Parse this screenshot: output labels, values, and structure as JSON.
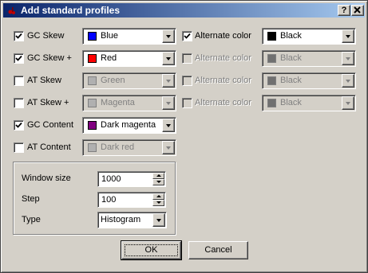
{
  "window": {
    "title": "Add standard profiles",
    "help_label": "?",
    "close_label": "✕"
  },
  "profiles": [
    {
      "label": "GC Skew",
      "checked": true,
      "enabled": true,
      "color_name": "Blue",
      "color": "#0000ff",
      "alt_label": "Alternate color",
      "alt_checked": true,
      "alt_enabled": true,
      "alt_color_name": "Black",
      "alt_color": "#000000"
    },
    {
      "label": "GC Skew +",
      "checked": true,
      "enabled": true,
      "color_name": "Red",
      "color": "#ff0000",
      "alt_label": "Alternate color",
      "alt_checked": false,
      "alt_enabled": false,
      "alt_color_name": "Black",
      "alt_color": "#000000"
    },
    {
      "label": "AT Skew",
      "checked": false,
      "enabled": false,
      "color_name": "Green",
      "color": "#00c000",
      "alt_label": "Alternate color",
      "alt_checked": false,
      "alt_enabled": false,
      "alt_color_name": "Black",
      "alt_color": "#000000"
    },
    {
      "label": "AT Skew +",
      "checked": false,
      "enabled": false,
      "color_name": "Magenta",
      "color": "#ff00ff",
      "alt_label": "Alternate color",
      "alt_checked": false,
      "alt_enabled": false,
      "alt_color_name": "Black",
      "alt_color": "#000000"
    },
    {
      "label": "GC Content",
      "checked": true,
      "enabled": true,
      "color_name": "Dark magenta",
      "color": "#800080"
    },
    {
      "label": "AT Content",
      "checked": false,
      "enabled": false,
      "color_name": "Dark red",
      "color": "#800000"
    }
  ],
  "settings": {
    "window_size_label": "Window size",
    "window_size_value": "1000",
    "step_label": "Step",
    "step_value": "100",
    "type_label": "Type",
    "type_value": "Histogram"
  },
  "buttons": {
    "ok": "OK",
    "cancel": "Cancel"
  }
}
